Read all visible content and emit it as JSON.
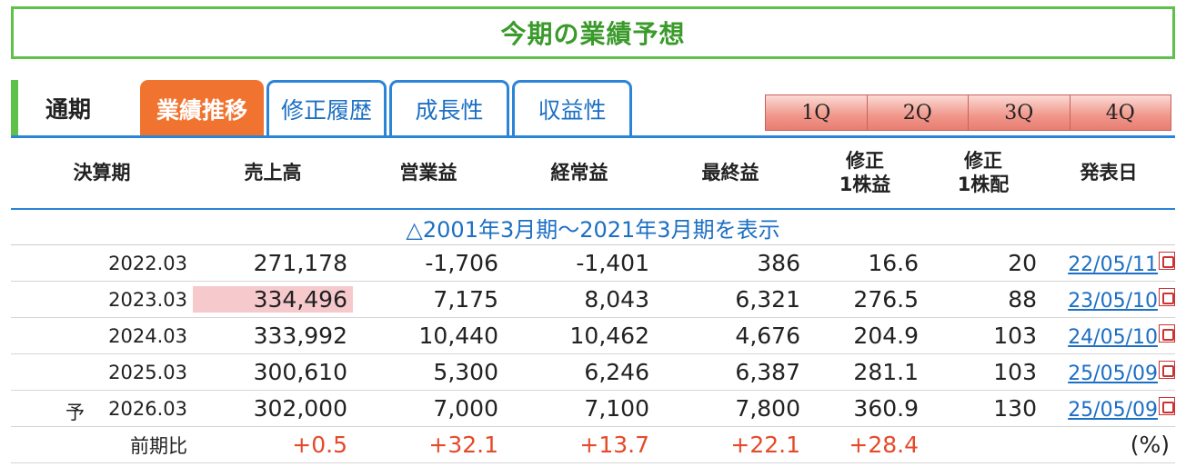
{
  "title": "今期の業績予想",
  "tabs": {
    "left_label": "通期",
    "items": [
      "業績推移",
      "修正履歴",
      "成長性",
      "収益性"
    ]
  },
  "quarter_buttons": [
    "1Q",
    "2Q",
    "3Q",
    "4Q"
  ],
  "table": {
    "headers": [
      "決算期",
      "売上高",
      "営業益",
      "経常益",
      "最終益",
      "修正\n1株益",
      "修正\n1株配",
      "発表日"
    ],
    "range_link": "△2001年3月期～2021年3月期を表示",
    "rows": [
      {
        "prefix": "",
        "period": "2022.03",
        "sales": "271,178",
        "op": "-1,706",
        "ord": "-1,401",
        "net": "386",
        "eps": "16.6",
        "div": "20",
        "date": "22/05/11"
      },
      {
        "prefix": "",
        "period": "2023.03",
        "sales": "334,496",
        "op": "7,175",
        "ord": "8,043",
        "net": "6,321",
        "eps": "276.5",
        "div": "88",
        "date": "23/05/10"
      },
      {
        "prefix": "",
        "period": "2024.03",
        "sales": "333,992",
        "op": "10,440",
        "ord": "10,462",
        "net": "4,676",
        "eps": "204.9",
        "div": "103",
        "date": "24/05/10"
      },
      {
        "prefix": "",
        "period": "2025.03",
        "sales": "300,610",
        "op": "5,300",
        "ord": "6,246",
        "net": "6,387",
        "eps": "281.1",
        "div": "103",
        "date": "25/05/09"
      },
      {
        "prefix": "予",
        "period": "2026.03",
        "sales": "302,000",
        "op": "7,000",
        "ord": "7,100",
        "net": "7,800",
        "eps": "360.9",
        "div": "130",
        "date": "25/05/09"
      }
    ],
    "comparison": {
      "label": "前期比",
      "sales": "+0.5",
      "op": "+32.1",
      "ord": "+13.7",
      "net": "+22.1",
      "eps": "+28.4",
      "unit": "(%)"
    }
  },
  "colors": {
    "green": "#5ec24a",
    "blue": "#2b84d6",
    "orange": "#f07430",
    "positive": "#e54a2a"
  }
}
